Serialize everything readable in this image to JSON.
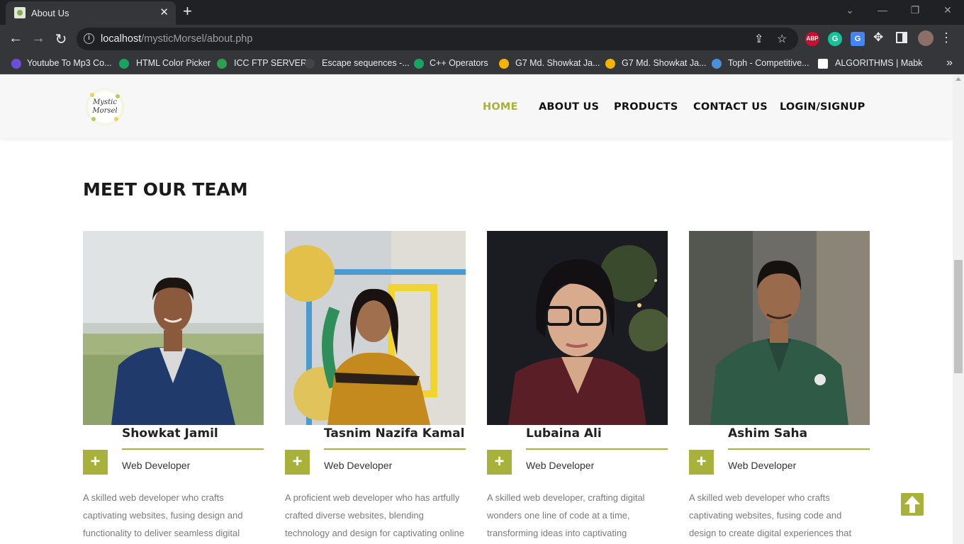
{
  "browser": {
    "tab_title": "About Us",
    "tab_close": "✕",
    "new_tab": "+",
    "url_host": "localhost",
    "url_path": "/mysticMorsel/about.php",
    "window_controls": [
      "⌄",
      "—",
      "❐",
      "✕"
    ],
    "extensions": [
      "ABP",
      "G",
      "G"
    ],
    "bookmarks_more": "»",
    "bookmarks": [
      {
        "label": "Youtube To Mp3 Co...",
        "color": "#6b4fd8"
      },
      {
        "label": "HTML Color Picker",
        "color": "#1aa260"
      },
      {
        "label": "ICC FTP SERVER",
        "color": "#2e9e4f"
      },
      {
        "label": "Escape sequences -...",
        "color": "#444444"
      },
      {
        "label": "C++ Operators",
        "color": "#1aa260"
      },
      {
        "label": "G7 Md. Showkat Ja...",
        "color": "#f4b400"
      },
      {
        "label": "G7 Md. Showkat Ja...",
        "color": "#f4b400"
      },
      {
        "label": "Toph - Competitive...",
        "color": "#4a90d9"
      },
      {
        "label": "ALGORITHMS | Mabk",
        "color": "#ffffff"
      }
    ]
  },
  "site": {
    "logo_text": "Mystic Morsel",
    "accent_color": "#a8b23a",
    "nav": [
      "HOME",
      "ABOUT US",
      "PRODUCTS",
      "CONTACT US",
      "LOGIN/SIGNUP"
    ],
    "active_nav": "HOME"
  },
  "team": {
    "title": "MEET OUR TEAM",
    "plus_label": "+",
    "members": [
      {
        "name": "Showkat Jamil",
        "role": "Web Developer",
        "description": "A skilled web developer who crafts captivating websites, fusing design and functionality to deliver seamless digital experiences."
      },
      {
        "name": "Tasnim Nazifa Kamal",
        "role": "Web Developer",
        "description": "A proficient web developer who has artfully crafted diverse websites, blending technology and design for captivating online experiences."
      },
      {
        "name": "Lubaina Ali",
        "role": "Web Developer",
        "description": "A skilled web developer, crafting digital wonders one line of code at a time, transforming ideas into captivating websites."
      },
      {
        "name": "Ashim Saha",
        "role": "Web Developer",
        "description": "A skilled web developer who crafts captivating websites, fusing code and design to create digital experiences that leave a lasting impact."
      }
    ]
  }
}
